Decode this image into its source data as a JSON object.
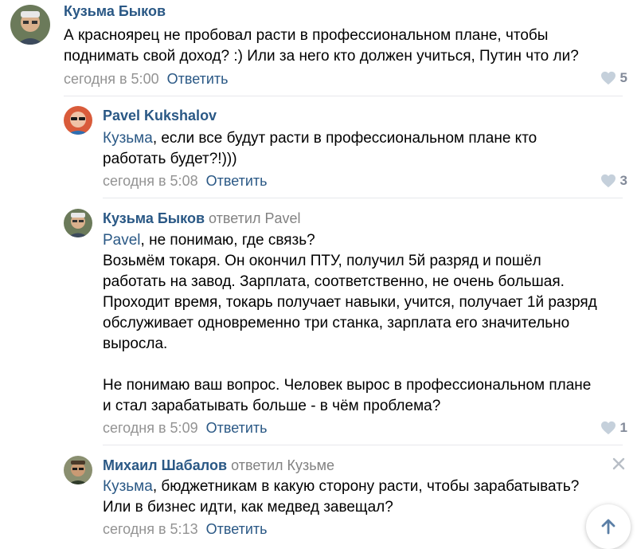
{
  "comments": [
    {
      "author": "Кузьма Быков",
      "reply_to": "",
      "mention": "",
      "text": "А красноярец не пробовал расти в профессиональном плане, чтобы\nподнимать свой доход? :) Или за него кто должен учиться, Путин что ли?",
      "time": "сегодня в 5:00",
      "reply_label": "Ответить",
      "likes": "5"
    },
    {
      "author": "Pavel Kukshalov",
      "reply_to": "",
      "mention": "Кузьма",
      "text": ", если все будут расти в профессиональном плане кто\nработать будет?!)))",
      "time": "сегодня в 5:08",
      "reply_label": "Ответить",
      "likes": "3"
    },
    {
      "author": "Кузьма Быков",
      "reply_to": "ответил Pavel",
      "mention": "Pavel",
      "text": ", не понимаю, где связь?\nВозьмём токаря. Он окончил ПТУ, получил 5й разряд и пошёл\nработать на завод. Зарплата, соответственно, не очень большая.\nПроходит время, токарь получает навыки, учится, получает 1й разряд\nобслуживает одновременно три станка, зарплата его значительно\nвыросла.\n\nНе понимаю ваш вопрос. Человек вырос в профессиональном плане\nи стал зарабатывать больше - в чём проблема?",
      "time": "сегодня в 5:09",
      "reply_label": "Ответить",
      "likes": "1"
    },
    {
      "author": "Михаил Шабалов",
      "reply_to": "ответил Кузьме",
      "mention": "Кузьма",
      "text": ", бюджетникам в какую сторону расти, чтобы зарабатывать?\nИли в бизнес идти, как медвед завещал?",
      "time": "сегодня в 5:13",
      "reply_label": "Ответить",
      "likes": ""
    }
  ],
  "colors": {
    "link": "#2a5885",
    "meta": "#939393",
    "divider": "#e7e8ec",
    "like_icon": "#c5d0db"
  },
  "icons": {
    "like": "heart-icon",
    "close": "close-icon",
    "scroll_up": "arrow-up-icon"
  }
}
